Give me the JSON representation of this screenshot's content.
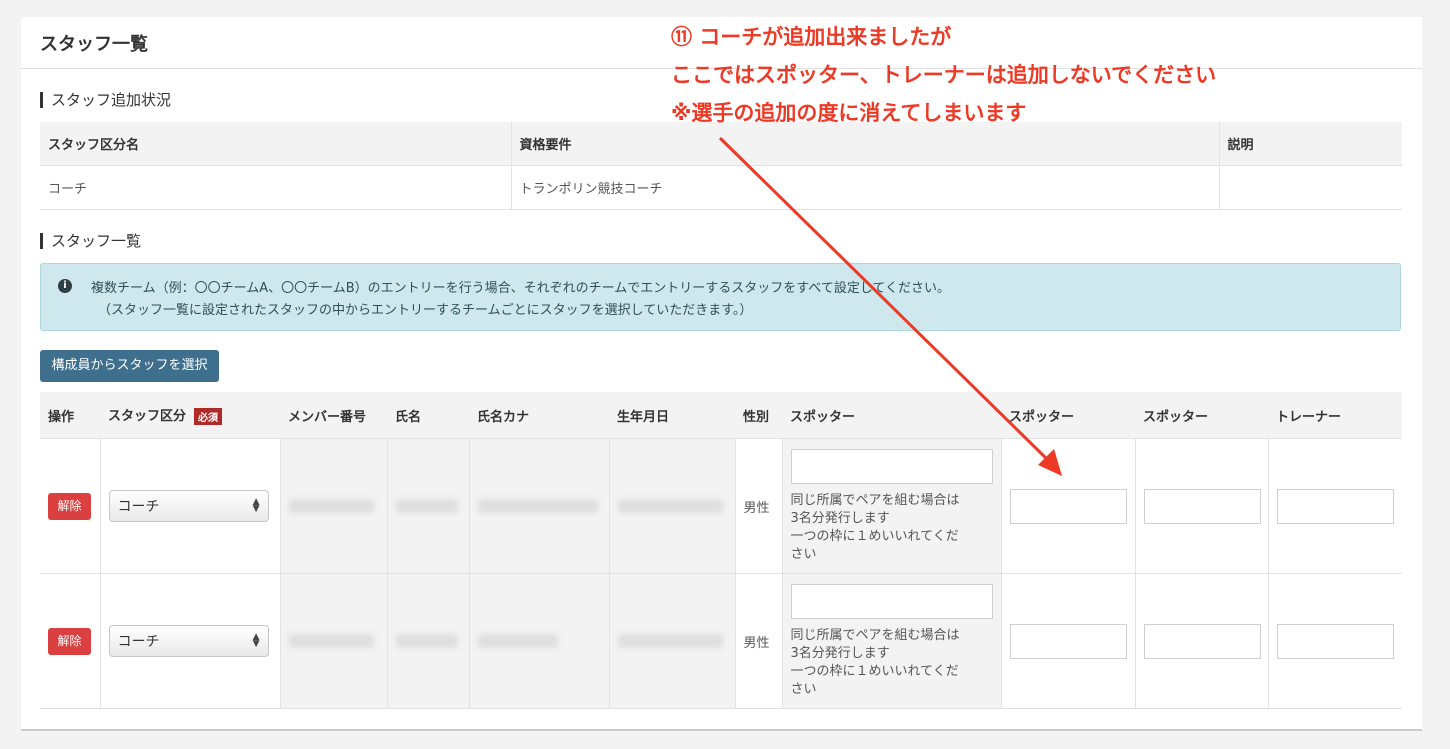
{
  "panel": {
    "title": "スタッフ一覧"
  },
  "status_section": {
    "heading": "スタッフ追加状況",
    "headers": [
      "スタッフ区分名",
      "資格要件",
      "説明"
    ],
    "rows": [
      {
        "category": "コーチ",
        "qualification": "トランポリン競技コーチ",
        "description": ""
      }
    ]
  },
  "list_section": {
    "heading": "スタッフ一覧",
    "info_line1": "複数チーム（例：〇〇チームA、〇〇チームB）のエントリーを行う場合、それぞれのチームでエントリーするスタッフをすべて設定してください。",
    "info_line2": "（スタッフ一覧に設定されたスタッフの中からエントリーするチームごとにスタッフを選択していただきます。）",
    "select_button": "構成員からスタッフを選択"
  },
  "staff_table": {
    "headers": {
      "op": "操作",
      "category": "スタッフ区分",
      "required": "必須",
      "member_no": "メンバー番号",
      "name": "氏名",
      "kana": "氏名カナ",
      "birthday": "生年月日",
      "gender": "性別",
      "spotter1": "スポッター",
      "spotter2": "スポッター",
      "spotter3": "スポッター",
      "trainer": "トレーナー"
    },
    "rows": [
      {
        "delete_label": "解除",
        "category": "コーチ",
        "gender": "男性",
        "hint_line1": "同じ所属でペアを組む場合は",
        "hint_line2": "3名分発行します",
        "hint_line3": "一つの枠に１めいいれてくだ",
        "hint_line4": "さい"
      },
      {
        "delete_label": "解除",
        "category": "コーチ",
        "gender": "男性",
        "hint_line1": "同じ所属でペアを組む場合は",
        "hint_line2": "3名分発行します",
        "hint_line3": "一つの枠に１めいいれてくだ",
        "hint_line4": "さい"
      }
    ]
  },
  "annotation": {
    "line1": "⑪ コーチが追加出来ましたが",
    "line2": "ここではスポッター、トレーナーは追加しないでください",
    "line3": "※選手の追加の度に消えてしまいます",
    "color": "#ec3a26"
  },
  "icons": {
    "info": "info-circle-icon",
    "select_arrows": "select-arrows-icon",
    "annotation_arrow": "arrow-icon"
  }
}
